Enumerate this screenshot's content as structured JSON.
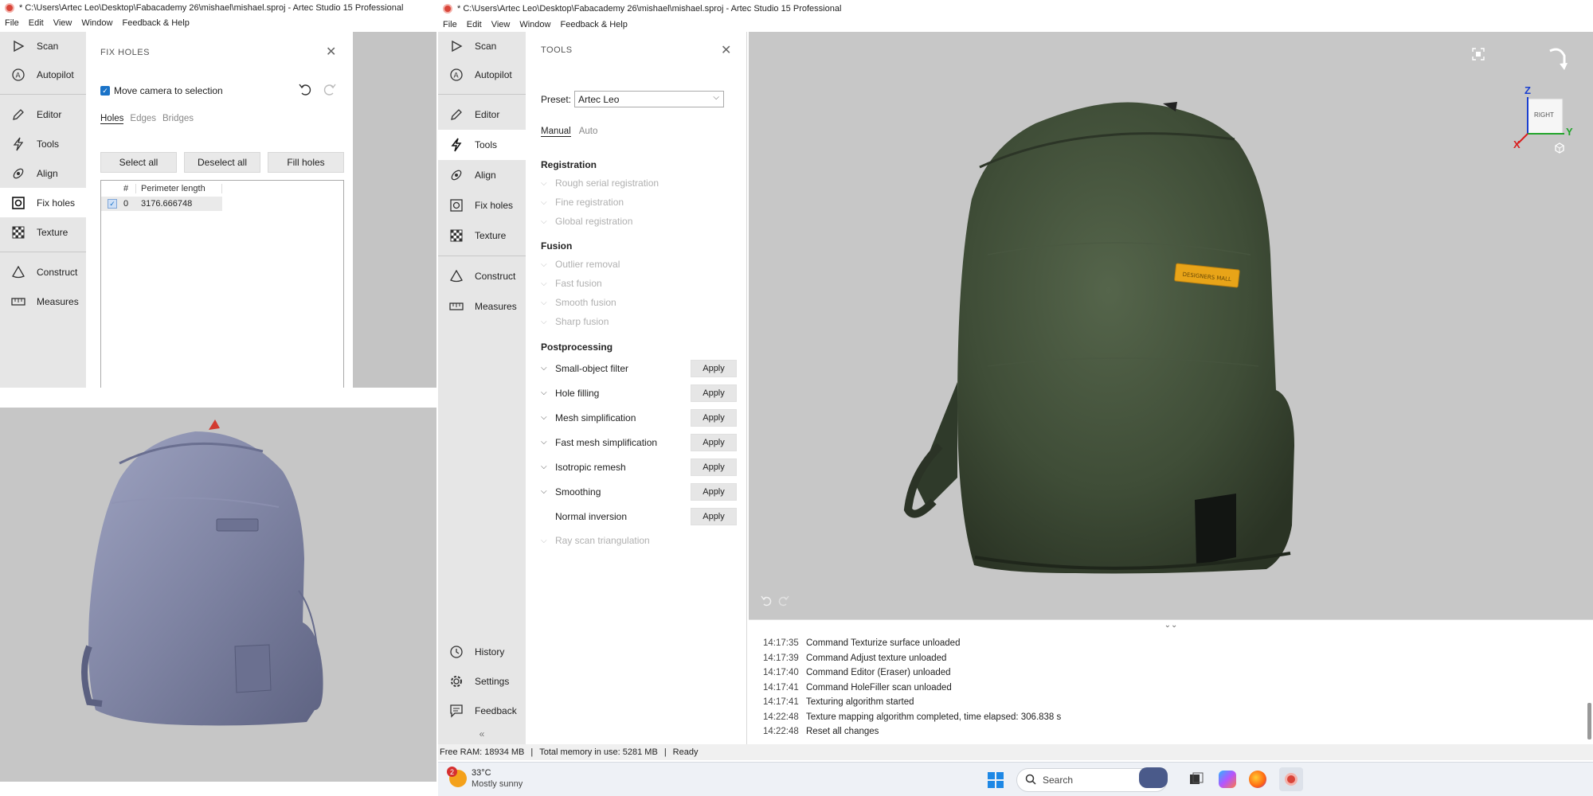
{
  "left_window": {
    "title": "* C:\\Users\\Artec Leo\\Desktop\\Fabacademy 26\\mishael\\mishael.sproj - Artec Studio 15 Professional",
    "menu": [
      "File",
      "Edit",
      "View",
      "Window",
      "Feedback & Help"
    ],
    "nav": [
      "Scan",
      "Autopilot",
      "Editor",
      "Tools",
      "Align",
      "Fix holes",
      "Texture",
      "Construct",
      "Measures"
    ],
    "fix_holes": {
      "title": "FIX HOLES",
      "move_camera_label": "Move camera to selection",
      "tabs": [
        "Holes",
        "Edges",
        "Bridges"
      ],
      "buttons": [
        "Select all",
        "Deselect all",
        "Fill holes"
      ],
      "table": {
        "headers": [
          "#",
          "Perimeter length"
        ],
        "rows": [
          {
            "index": "0",
            "perimeter": "3176.666748"
          }
        ]
      }
    }
  },
  "right_window": {
    "title": "* C:\\Users\\Artec Leo\\Desktop\\Fabacademy 26\\mishael\\mishael.sproj - Artec Studio 15 Professional",
    "menu": [
      "File",
      "Edit",
      "View",
      "Window",
      "Feedback & Help"
    ],
    "nav": [
      "Scan",
      "Autopilot",
      "Editor",
      "Tools",
      "Align",
      "Fix holes",
      "Texture",
      "Construct",
      "Measures"
    ],
    "nav_bottom": [
      "History",
      "Settings",
      "Feedback"
    ],
    "tools": {
      "title": "TOOLS",
      "preset_label": "Preset:",
      "preset_value": "Artec Leo",
      "modes": [
        "Manual",
        "Auto"
      ],
      "registration_header": "Registration",
      "registration": [
        "Rough serial registration",
        "Fine registration",
        "Global registration"
      ],
      "fusion_header": "Fusion",
      "fusion": [
        "Outlier removal",
        "Fast fusion",
        "Smooth fusion",
        "Sharp fusion"
      ],
      "postprocessing_header": "Postprocessing",
      "postprocessing": [
        "Small-object filter",
        "Hole filling",
        "Mesh simplification",
        "Fast mesh simplification",
        "Isotropic remesh",
        "Smoothing",
        "Normal inversion"
      ],
      "apply_label": "Apply",
      "ray_scan": "Ray scan triangulation"
    },
    "viewcube_label": "RIGHT",
    "axes": {
      "z": "Z",
      "y": "Y",
      "x": "X"
    },
    "patch_label": "DESIGNERS MALL",
    "log": [
      {
        "time": "14:17:35",
        "text": "Command Texturize surface unloaded"
      },
      {
        "time": "14:17:39",
        "text": "Command Adjust texture unloaded"
      },
      {
        "time": "14:17:40",
        "text": "Command Editor (Eraser) unloaded"
      },
      {
        "time": "14:17:41",
        "text": "Command HoleFiller scan unloaded"
      },
      {
        "time": "14:17:41",
        "text": "Texturing algorithm started"
      },
      {
        "time": "14:22:48",
        "text": "Texture mapping algorithm completed, time elapsed: 306.838 s"
      },
      {
        "time": "14:22:48",
        "text": "Reset all changes"
      }
    ],
    "status": {
      "free_ram": "Free RAM: 18934 MB",
      "total_memory": "Total memory in use: 5281 MB",
      "state": "Ready"
    }
  },
  "taskbar": {
    "weather_temp": "33°C",
    "weather_desc": "Mostly sunny",
    "weather_badge": "2",
    "search_placeholder": "Search"
  },
  "colors": {
    "accent": "#1a73c8",
    "viewport_bg": "#c4c4c4",
    "scan_blue": "#7d82a0",
    "scan_green": "#3d4a34"
  }
}
